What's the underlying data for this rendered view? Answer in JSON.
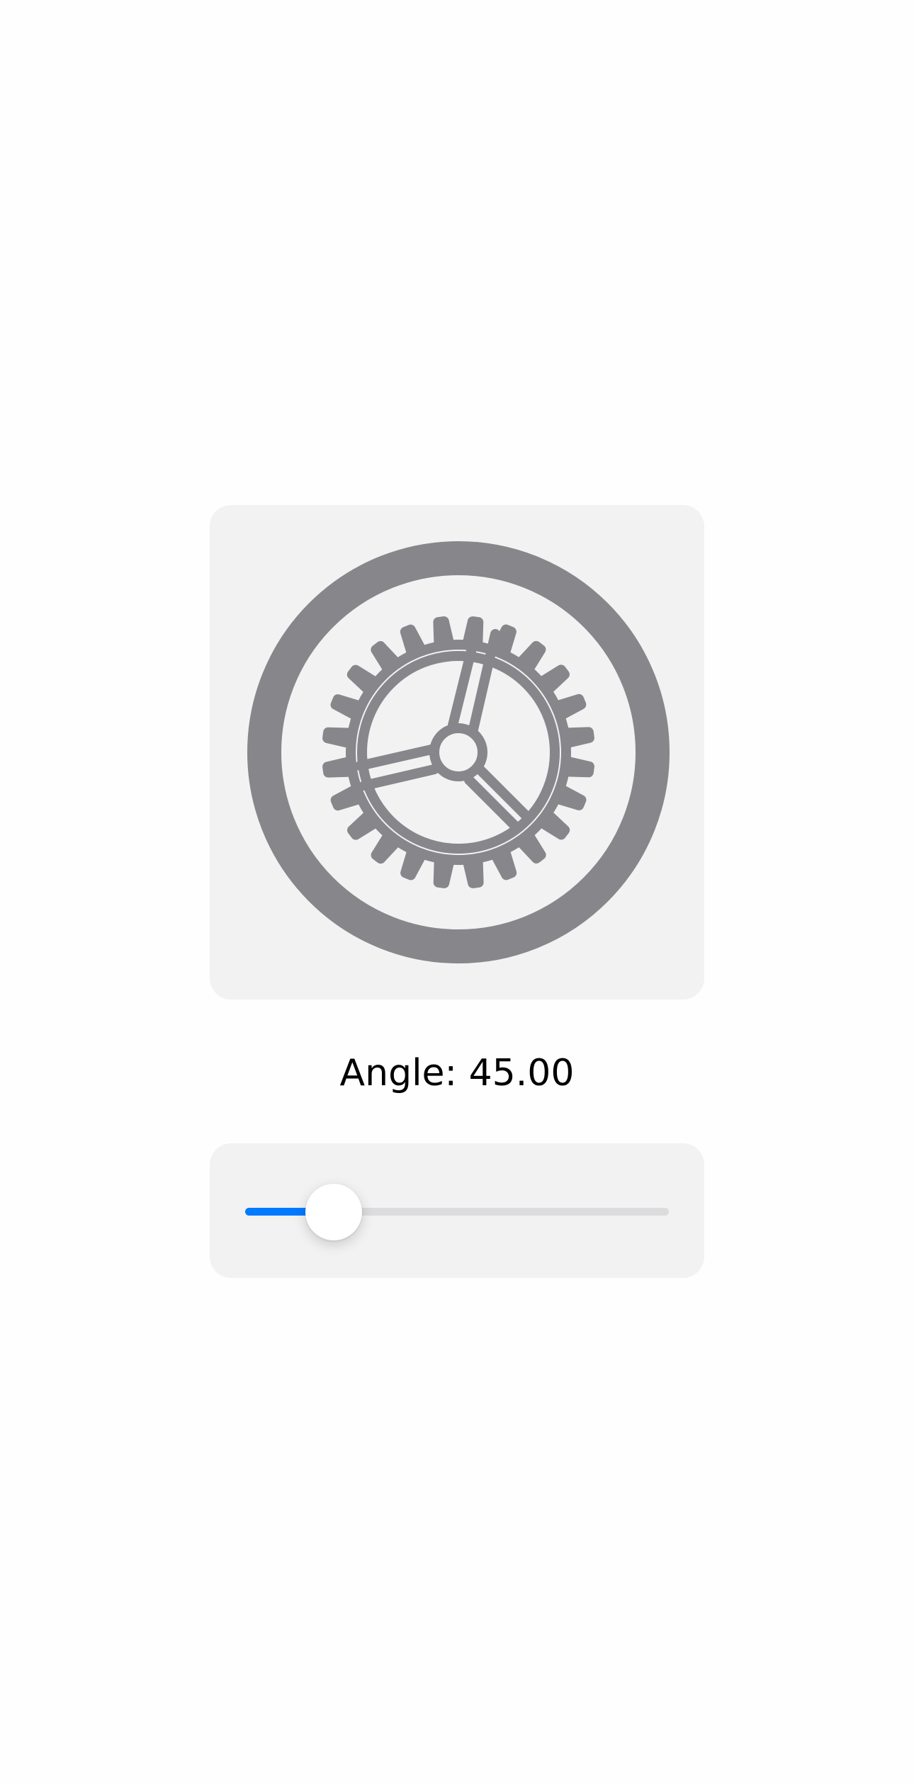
{
  "icon": {
    "name": "settings-gear-icon",
    "color": "#86868b"
  },
  "angle": {
    "text": "Angle: 45.00",
    "value": 45.0
  },
  "slider": {
    "min": 0,
    "max": 360,
    "value": 45.0,
    "fraction": 0.125,
    "fill_color": "#007aff",
    "track_color": "#dcdcde"
  }
}
